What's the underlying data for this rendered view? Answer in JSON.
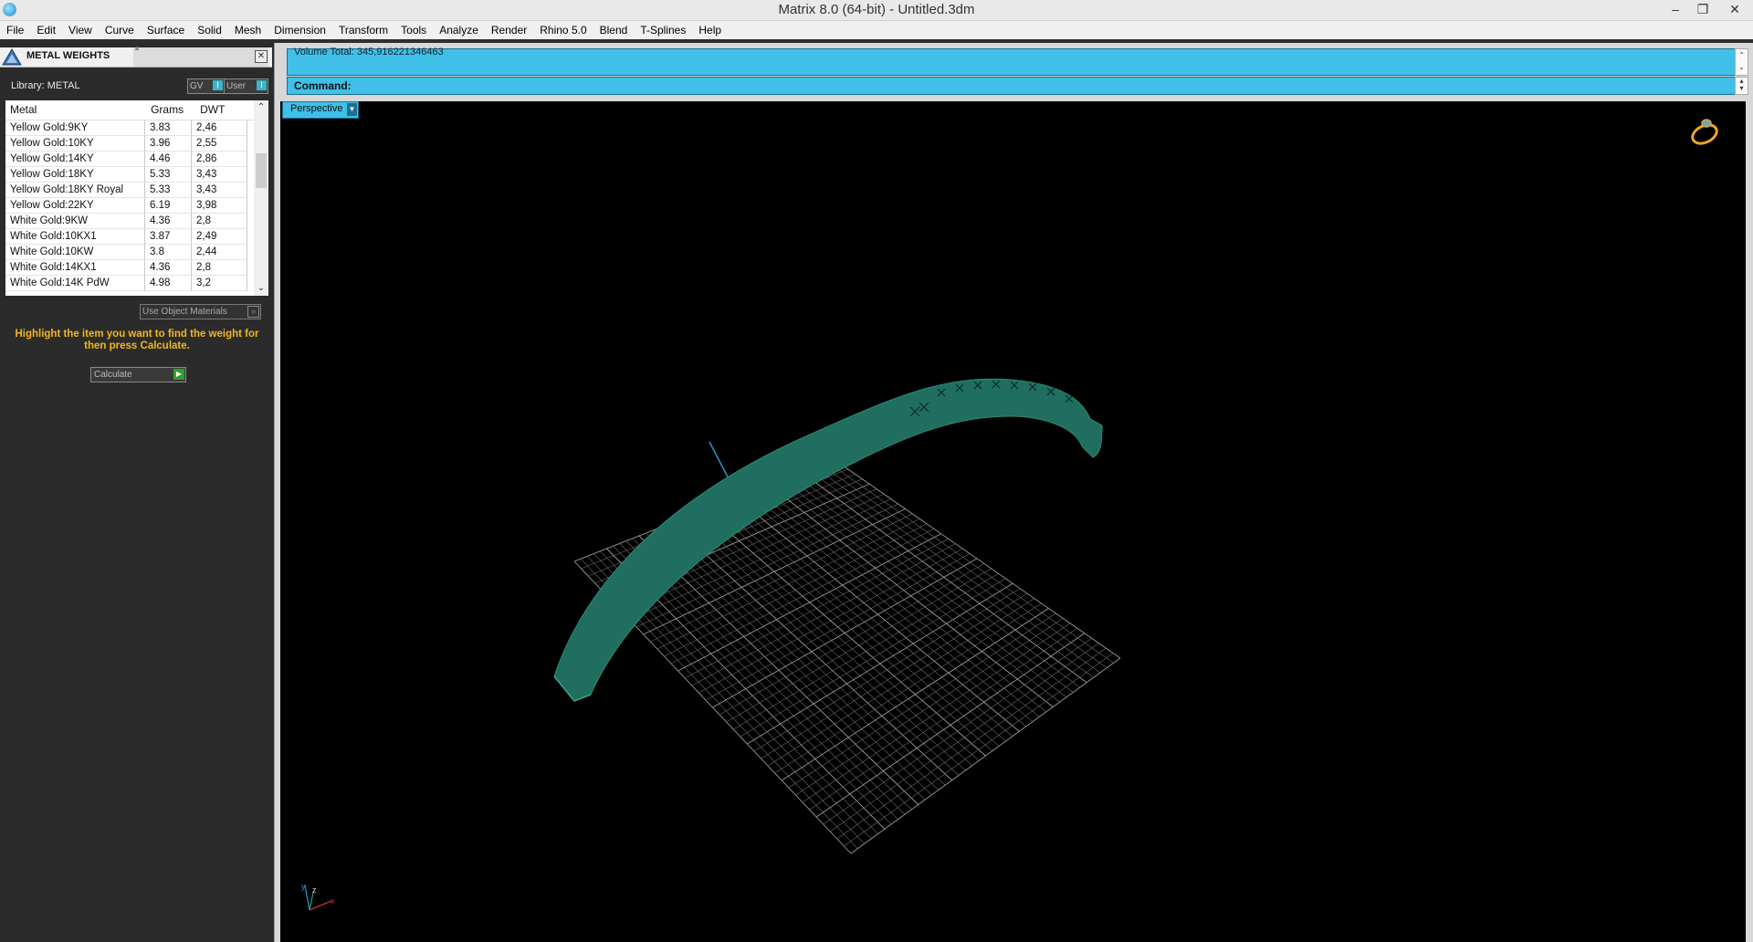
{
  "window": {
    "title": "Matrix 8.0 (64-bit) - Untitled.3dm"
  },
  "menu": [
    "File",
    "Edit",
    "View",
    "Curve",
    "Surface",
    "Solid",
    "Mesh",
    "Dimension",
    "Transform",
    "Tools",
    "Analyze",
    "Render",
    "Rhino 5.0",
    "Blend",
    "T-Splines",
    "Help"
  ],
  "panel": {
    "title": "METAL WEIGHTS",
    "library_label": "Library: METAL",
    "gv_label": "GV",
    "user_label": "User",
    "columns": [
      "Metal",
      "Grams",
      "DWT"
    ],
    "rows": [
      [
        "Yellow Gold:9KY",
        "3.83",
        "2,46"
      ],
      [
        "Yellow Gold:10KY",
        "3.96",
        "2,55"
      ],
      [
        "Yellow Gold:14KY",
        "4.46",
        "2,86"
      ],
      [
        "Yellow Gold:18KY",
        "5.33",
        "3,43"
      ],
      [
        "Yellow Gold:18KY Royal",
        "5.33",
        "3,43"
      ],
      [
        "Yellow Gold:22KY",
        "6.19",
        "3,98"
      ],
      [
        "White Gold:9KW",
        "4.36",
        "2,8"
      ],
      [
        "White Gold:10KX1",
        "3.87",
        "2,49"
      ],
      [
        "White Gold:10KW",
        "3.8",
        "2,44"
      ],
      [
        "White Gold:14KX1",
        "4.36",
        "2,8"
      ],
      [
        "White Gold:14K PdW",
        "4.98",
        "3,2"
      ]
    ],
    "use_object_materials": "Use Object Materials",
    "instruction": "Highlight the item you want to find the weight for then press Calculate.",
    "calculate_label": "Calculate"
  },
  "command": {
    "history_text": "Volume Total: 345,916221346463",
    "command_label": "Command:"
  },
  "viewport": {
    "name": "Perspective",
    "axis_labels": {
      "y": "y",
      "z": "z",
      "x": "x"
    }
  },
  "colors": {
    "accent": "#40c0e8",
    "model": "#1f6e5f",
    "instruction": "#f2b51d"
  }
}
